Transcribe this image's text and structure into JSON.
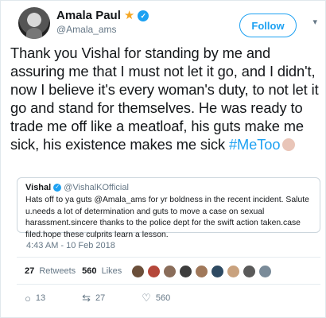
{
  "author": {
    "display_name": "Amala Paul",
    "handle": "@Amala_ams",
    "badge_icon": "star-icon",
    "verified_icon": "verified-icon"
  },
  "follow_label": "Follow",
  "tweet": {
    "text": "Thank you Vishal for standing by me and assuring me that I must not let it go, and I didn't, now I believe it's every woman's duty, to not let it go and stand for themselves. He was ready to trade me off like a meatloaf, his guts make me sick, his existence makes me sick",
    "hashtag": "#MeToo",
    "emoji_icon": "praying-hands-icon"
  },
  "quoted": {
    "name": "Vishal",
    "handle": "@VishalKOfficial",
    "text": "Hats off to ya guts @Amala_ams for yr boldness in the recent incident. Salute u.needs a lot of determination and guts to move a case on sexual harassment.sincere thanks to the police dept for the swift action taken.case filed.hope these culprits learn a lesson."
  },
  "timestamp": "4:43 AM - 10 Feb 2018",
  "stats": {
    "retweets_count": "27",
    "retweets_label": "Retweets",
    "likes_count": "560",
    "likes_label": "Likes"
  },
  "liker_colors": [
    "#6b4f3a",
    "#b5473a",
    "#8a6d5a",
    "#3d3d3d",
    "#a0785a",
    "#2e4a62",
    "#c9a27e",
    "#5a5a5a",
    "#7a8b99"
  ],
  "actions": {
    "reply_count": "13",
    "retweet_count": "27",
    "like_count": "560"
  },
  "colors": {
    "accent": "#1da1f2",
    "star": "#f5a623"
  }
}
